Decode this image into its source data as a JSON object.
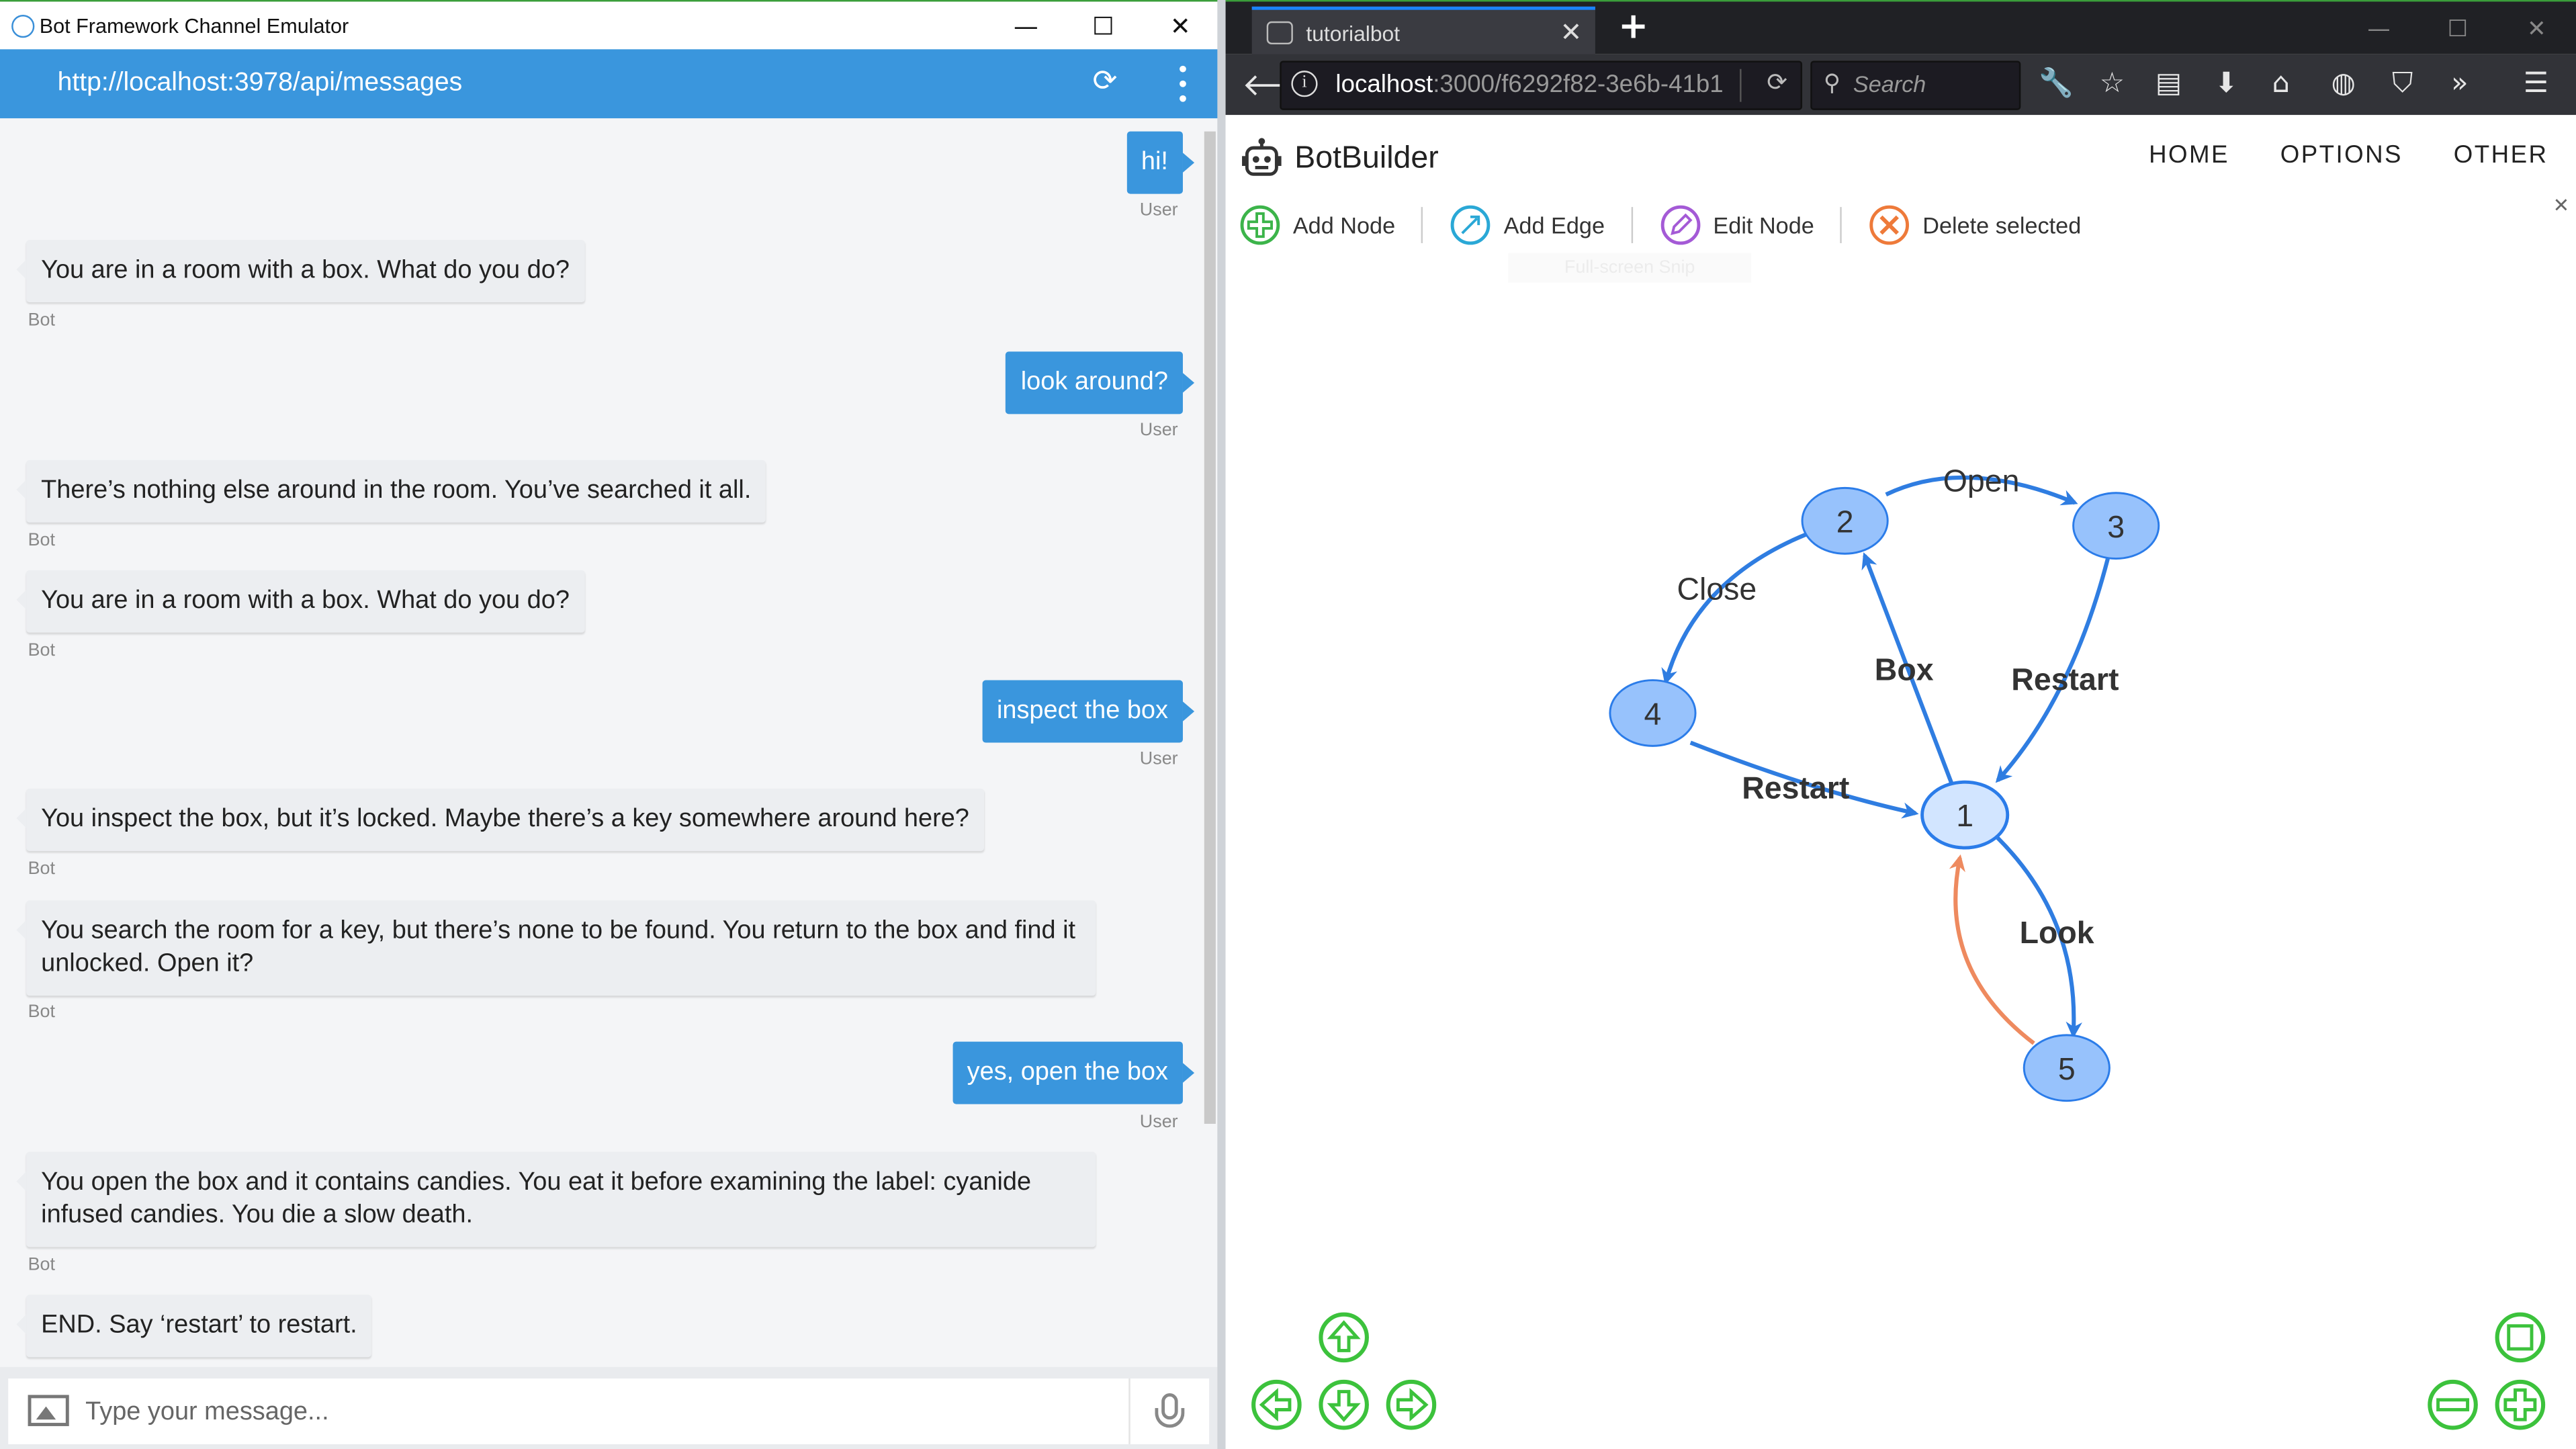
{
  "emulator": {
    "window_title": "Bot Framework Channel Emulator",
    "window_controls": [
      "—",
      "☐",
      "✕"
    ],
    "endpoint_url": "http://localhost:3978/api/messages",
    "messages": [
      {
        "from": "user",
        "text": "hi!",
        "sender_label": "User"
      },
      {
        "from": "bot",
        "text": "You are in a room with a box. What do you do?",
        "sender_label": "Bot"
      },
      {
        "from": "user",
        "text": "look around?",
        "sender_label": "User"
      },
      {
        "from": "bot",
        "text": "There’s nothing else around in the room. You’ve searched it all.",
        "sender_label": "Bot"
      },
      {
        "from": "bot",
        "text": "You are in a room with a box. What do you do?",
        "sender_label": "Bot"
      },
      {
        "from": "user",
        "text": "inspect the box",
        "sender_label": "User"
      },
      {
        "from": "bot",
        "text": "You inspect the box, but it’s locked. Maybe there’s a key somewhere around here?",
        "sender_label": "Bot"
      },
      {
        "from": "bot",
        "text": "You search the room for a key, but there’s none to be found. You return to the box and find it unlocked. Open it?",
        "sender_label": "Bot"
      },
      {
        "from": "user",
        "text": "yes, open the box",
        "sender_label": "User"
      },
      {
        "from": "bot",
        "text": "You open the box and it contains candies. You eat it before examining the label: cyanide infused candies. You die a slow death.",
        "sender_label": "Bot"
      },
      {
        "from": "bot",
        "text": "END. Say ‘restart’ to restart.",
        "sender_label": ""
      }
    ],
    "composer": {
      "placeholder": "Type your message..."
    }
  },
  "browser": {
    "tab": {
      "title": "tutorialbot"
    },
    "window_controls": [
      "—",
      "☐",
      "✕"
    ],
    "address": {
      "host": "localhost",
      "path": ":3000/f6292f82-3e6b-41b1"
    },
    "search": {
      "placeholder": "Search"
    },
    "app": {
      "brand": "BotBuilder",
      "nav": [
        "HOME",
        "OPTIONS",
        "OTHER"
      ],
      "toolbar": {
        "add_node": "Add Node",
        "add_edge": "Add Edge",
        "edit_node": "Edit Node",
        "delete_selected": "Delete selected"
      },
      "tooltip_ghost": "Full-screen Snip"
    },
    "graph": {
      "nodes": [
        {
          "id": "1",
          "label": "1",
          "selected": true
        },
        {
          "id": "2",
          "label": "2"
        },
        {
          "id": "3",
          "label": "3"
        },
        {
          "id": "4",
          "label": "4"
        },
        {
          "id": "5",
          "label": "5"
        }
      ],
      "edges": [
        {
          "from": "2",
          "to": "3",
          "label": "Open",
          "color": "#2f7de1"
        },
        {
          "from": "2",
          "to": "4",
          "label": "Close",
          "color": "#2f7de1"
        },
        {
          "from": "1",
          "to": "2",
          "label": "Box",
          "color": "#2f7de1"
        },
        {
          "from": "3",
          "to": "1",
          "label": "Restart",
          "color": "#2f7de1"
        },
        {
          "from": "4",
          "to": "1",
          "label": "Restart",
          "color": "#2f7de1"
        },
        {
          "from": "1",
          "to": "5",
          "label": "Look",
          "color": "#2f7de1"
        },
        {
          "from": "5",
          "to": "1",
          "label": "",
          "color": "#ee8a5f"
        }
      ],
      "colors": {
        "node_fill": "#97c2fc",
        "node_selected_fill": "#d2e5ff",
        "node_border": "#2b7ce9",
        "nav_green": "#3cc23c"
      }
    }
  }
}
